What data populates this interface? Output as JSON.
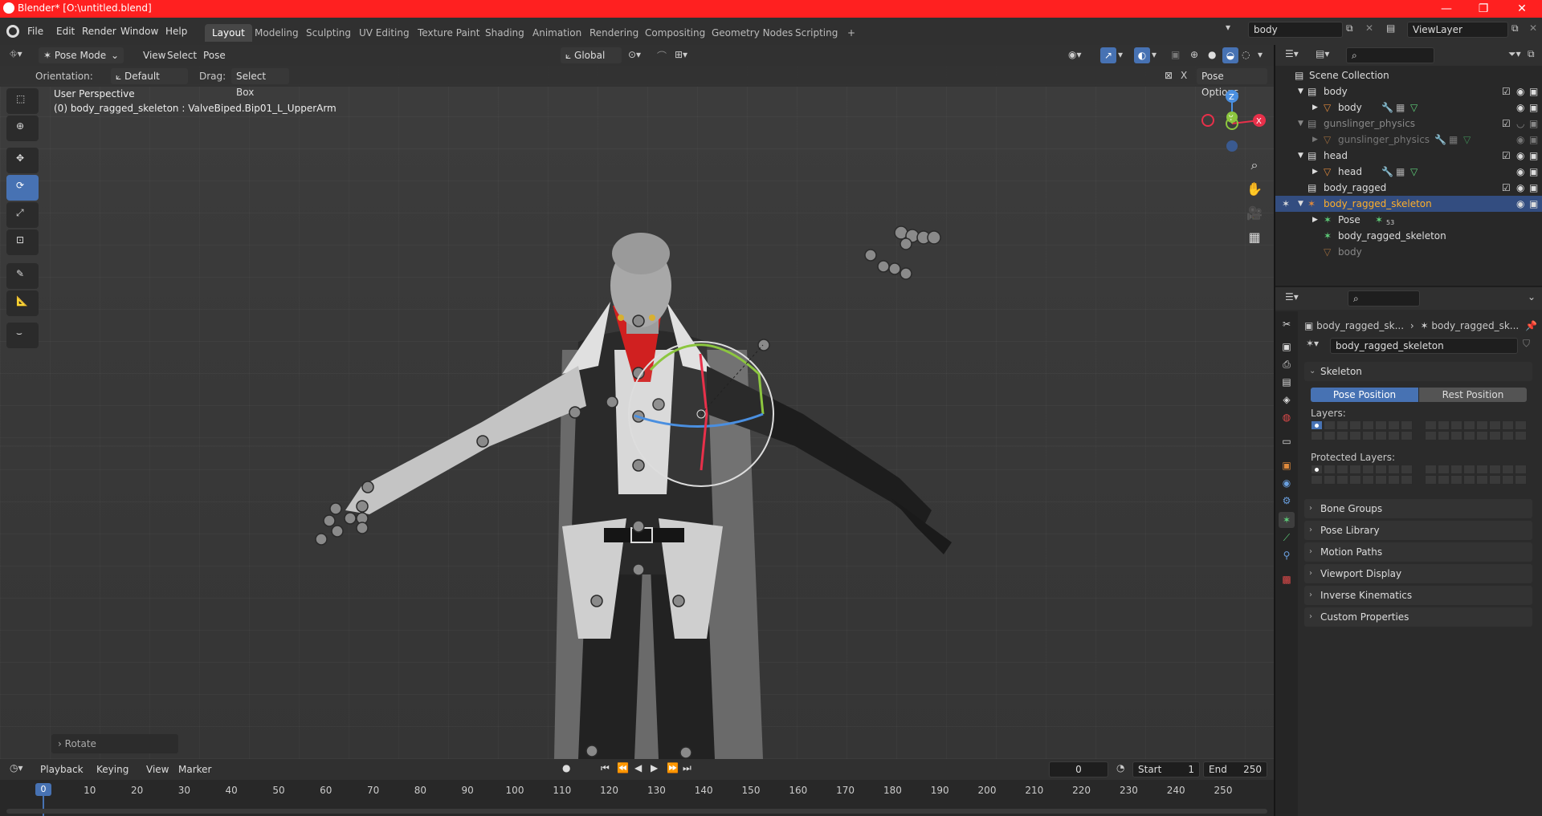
{
  "window": {
    "title": "Blender* [O:\\untitled.blend]",
    "min": "—",
    "restore": "❐",
    "close": "✕"
  },
  "menus": [
    "File",
    "Edit",
    "Render",
    "Window",
    "Help"
  ],
  "workspaces": [
    "Layout",
    "Modeling",
    "Sculpting",
    "UV Editing",
    "Texture Paint",
    "Shading",
    "Animation",
    "Rendering",
    "Compositing",
    "Geometry Nodes",
    "Scripting",
    "+"
  ],
  "scene": {
    "name": "body",
    "view_layer": "ViewLayer"
  },
  "viewport": {
    "mode": "Pose Mode",
    "menus": [
      "View",
      "Select",
      "Pose"
    ],
    "transform_orientation": "Global",
    "orientation_label": "Orientation:",
    "orientation_value": "Default",
    "drag_label": "Drag:",
    "drag_value": "Select Box",
    "pose_options": "Pose Options",
    "perspective": "User Perspective",
    "active_bone": "(0) body_ragged_skeleton : ValveBiped.Bip01_L_UpperArm",
    "last_op": "Rotate",
    "gizmo": {
      "z": "Z",
      "y": "Y",
      "x": "X"
    }
  },
  "timeline": {
    "menus": [
      "Playback",
      "Keying",
      "View",
      "Marker"
    ],
    "current_frame": "0",
    "start_label": "Start",
    "start": "1",
    "end_label": "End",
    "end": "250",
    "ticks": [
      "0",
      "10",
      "20",
      "30",
      "40",
      "50",
      "60",
      "70",
      "80",
      "90",
      "100",
      "110",
      "120",
      "130",
      "140",
      "150",
      "160",
      "170",
      "180",
      "190",
      "200",
      "210",
      "220",
      "230",
      "240",
      "250"
    ]
  },
  "outliner": {
    "rows": [
      {
        "label": "Scene Collection"
      },
      {
        "label": "body"
      },
      {
        "label": "body"
      },
      {
        "label": "gunslinger_physics"
      },
      {
        "label": "gunslinger_physics"
      },
      {
        "label": "head"
      },
      {
        "label": "head"
      },
      {
        "label": "body_ragged"
      },
      {
        "label": "body_ragged_skeleton"
      },
      {
        "label": "Pose"
      },
      {
        "label": "body_ragged_skeleton"
      },
      {
        "label": "body"
      }
    ],
    "pose_badge": "53"
  },
  "properties": {
    "breadcrumb_1": "body_ragged_sk...",
    "breadcrumb_2": "body_ragged_sk...",
    "datablock": "body_ragged_skeleton",
    "skeleton_panel": "Skeleton",
    "pose_position": "Pose Position",
    "rest_position": "Rest Position",
    "layers_label": "Layers:",
    "protected_label": "Protected Layers:",
    "panels": [
      "Bone Groups",
      "Pose Library",
      "Motion Paths",
      "Viewport Display",
      "Inverse Kinematics",
      "Custom Properties"
    ]
  },
  "colors": {
    "accent": "#4772b3",
    "title": "#ff2020",
    "selected_row": "#334d80",
    "orange": "#e08a3c"
  }
}
